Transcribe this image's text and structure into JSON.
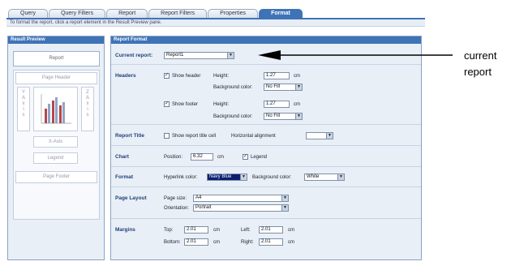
{
  "tabs": [
    "Query",
    "Query Filters",
    "Report",
    "Report Filters",
    "Properties",
    "Format"
  ],
  "info": "To format the report, click a report element in the Result Preview pane.",
  "preview": {
    "title": "Result Preview",
    "report": "Report",
    "page_header": "Page Header",
    "y_axis": "Y\nA\nx\ni\ns",
    "z_axis": "Z\nA\nx\ni\ns",
    "x_axis": "X-Axis",
    "legend": "Legend",
    "page_footer": "Page Footer"
  },
  "format": {
    "title": "Report Format",
    "current_report_label": "Current report:",
    "current_report_value": "Report1",
    "headers_label": "Headers",
    "show_header": "Show header",
    "show_header_checked": true,
    "height_label": "Height:",
    "header_height": "1.27",
    "cm": "cm",
    "bg_color_label": "Background color:",
    "header_bg": "No Fill",
    "show_footer": "Show footer",
    "show_footer_checked": true,
    "footer_height": "1.27",
    "footer_bg": "No Fill",
    "report_title_label": "Report Title",
    "show_title": "Show report title cell",
    "show_title_checked": false,
    "h_align_label": "Horizontal alignment",
    "h_align_value": "",
    "chart_label": "Chart",
    "position_label": "Position:",
    "position_value": "6.32",
    "legend_label": "Legend",
    "legend_checked": true,
    "format_label": "Format",
    "hyperlink_label": "Hyperlink color:",
    "hyperlink_value": "Navy Blue",
    "bg_label": "Background color:",
    "bg_value": "White",
    "page_layout_label": "Page Layout",
    "page_size_label": "Page size:",
    "page_size_value": "A4",
    "orientation_label": "Orientation:",
    "orientation_value": "Portrait",
    "margins_label": "Margins",
    "top_label": "Top:",
    "top_value": "2.01",
    "left_label": "Left:",
    "left_value": "2.01",
    "bottom_label": "Bottom:",
    "bottom_value": "2.01",
    "right_label": "Right:",
    "right_value": "2.01"
  },
  "annotation": "current\nreport",
  "colors": {
    "accent": "#3f73b8",
    "panel": "#e9eff7",
    "selected": "#0a1f6e"
  }
}
